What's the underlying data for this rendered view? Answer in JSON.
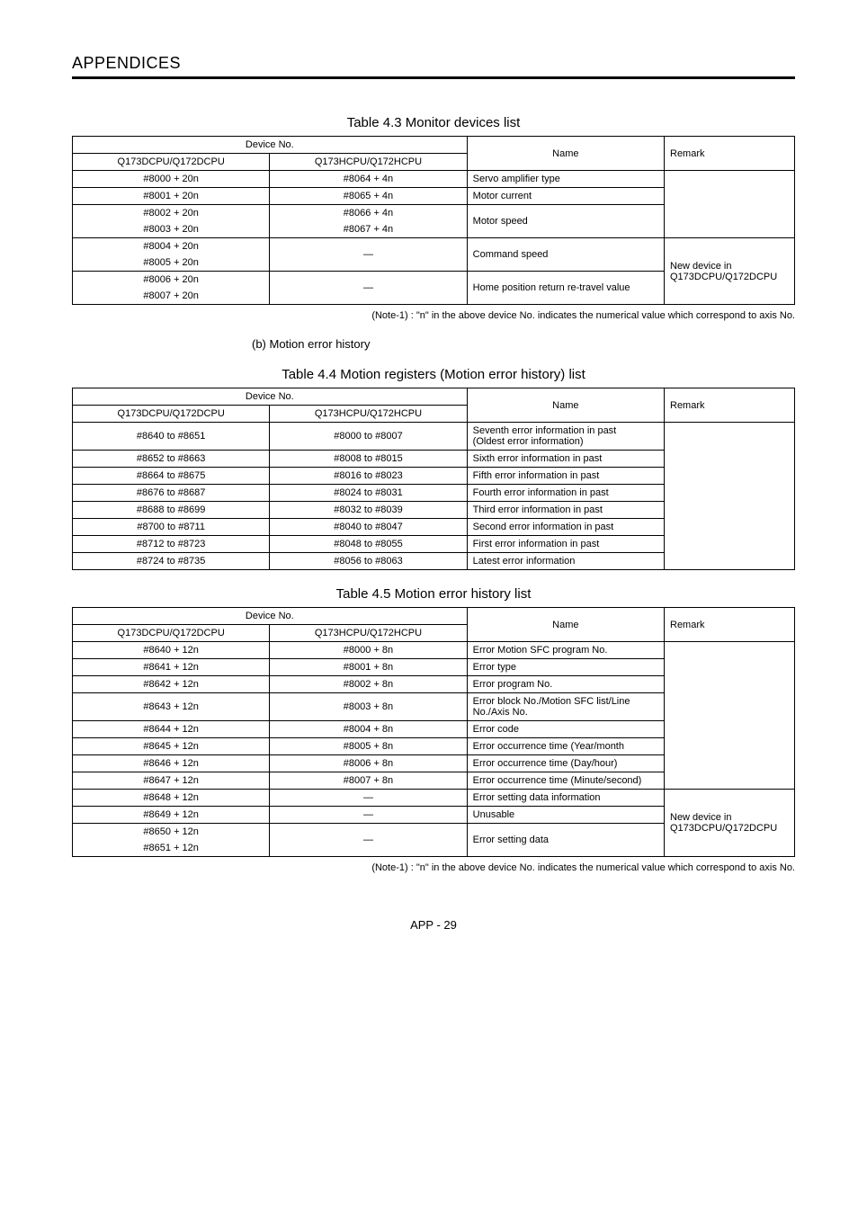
{
  "page": {
    "header": "APPENDICES",
    "footer": "APP - 29"
  },
  "table43": {
    "caption": "Table 4.3 Monitor devices list",
    "headers": {
      "device": "Device No.",
      "c1": "Q173DCPU/Q172DCPU",
      "c2": "Q173HCPU/Q172HCPU",
      "name": "Name",
      "remark": "Remark"
    },
    "rows": [
      {
        "d1": "#8000 + 20n",
        "d2": "#8064 + 4n",
        "name": "Servo amplifier type"
      },
      {
        "d1": "#8001 + 20n",
        "d2": "#8065 + 4n",
        "name": "Motor current"
      },
      {
        "d1a": "#8002 + 20n",
        "d1b": "#8003 + 20n",
        "d2a": "#8066 + 4n",
        "d2b": "#8067 + 4n",
        "name": "Motor speed"
      },
      {
        "d1a": "#8004 + 20n",
        "d1b": "#8005 + 20n",
        "d2": "—",
        "name": "Command speed"
      },
      {
        "d1a": "#8006 + 20n",
        "d1b": "#8007 + 20n",
        "d2": "—",
        "name": "Home position return re-travel value"
      }
    ],
    "remark_merged": "New device in Q173DCPU/Q172DCPU",
    "note": "(Note-1) : \"n\" in the above device No. indicates the numerical value which correspond to axis No."
  },
  "subsection_b": "(b)   Motion error history",
  "table44": {
    "caption": "Table 4.4 Motion registers (Motion error history) list",
    "headers": {
      "device": "Device No.",
      "c1": "Q173DCPU/Q172DCPU",
      "c2": "Q173HCPU/Q172HCPU",
      "name": "Name",
      "remark": "Remark"
    },
    "rows": [
      {
        "d1": "#8640 to #8651",
        "d2": "#8000 to #8007",
        "name": "Seventh error information in past\n(Oldest error information)"
      },
      {
        "d1": "#8652 to #8663",
        "d2": "#8008 to #8015",
        "name": "Sixth error information in past"
      },
      {
        "d1": "#8664 to #8675",
        "d2": "#8016 to #8023",
        "name": "Fifth error information in past"
      },
      {
        "d1": "#8676 to #8687",
        "d2": "#8024 to #8031",
        "name": "Fourth error information in past"
      },
      {
        "d1": "#8688 to #8699",
        "d2": "#8032 to #8039",
        "name": "Third error information in past"
      },
      {
        "d1": "#8700 to #8711",
        "d2": "#8040 to #8047",
        "name": "Second error information in past"
      },
      {
        "d1": "#8712 to #8723",
        "d2": "#8048 to #8055",
        "name": "First error information in past"
      },
      {
        "d1": "#8724 to #8735",
        "d2": "#8056 to #8063",
        "name": "Latest error information"
      }
    ]
  },
  "table45": {
    "caption": "Table 4.5 Motion error history list",
    "headers": {
      "device": "Device No.",
      "c1": "Q173DCPU/Q172DCPU",
      "c2": "Q173HCPU/Q172HCPU",
      "name": "Name",
      "remark": "Remark"
    },
    "rows": [
      {
        "d1": "#8640 + 12n",
        "d2": "#8000 + 8n",
        "name": "Error Motion SFC program No."
      },
      {
        "d1": "#8641 + 12n",
        "d2": "#8001 + 8n",
        "name": "Error type"
      },
      {
        "d1": "#8642 + 12n",
        "d2": "#8002 + 8n",
        "name": "Error program No."
      },
      {
        "d1": "#8643 + 12n",
        "d2": "#8003 + 8n",
        "name": "Error block No./Motion SFC list/Line No./Axis No."
      },
      {
        "d1": "#8644 + 12n",
        "d2": "#8004 + 8n",
        "name": "Error code"
      },
      {
        "d1": "#8645 + 12n",
        "d2": "#8005 + 8n",
        "name": "Error occurrence time (Year/month"
      },
      {
        "d1": "#8646 + 12n",
        "d2": "#8006 + 8n",
        "name": "Error occurrence time (Day/hour)"
      },
      {
        "d1": "#8647 + 12n",
        "d2": "#8007 + 8n",
        "name": "Error occurrence time (Minute/second)"
      },
      {
        "d1": "#8648 + 12n",
        "d2": "—",
        "name": "Error setting data information"
      },
      {
        "d1": "#8649 + 12n",
        "d2": "—",
        "name": "Unusable"
      },
      {
        "d1a": "#8650 + 12n",
        "d1b": "#8651 + 12n",
        "d2": "—",
        "name": "Error setting data"
      }
    ],
    "remark_merged": "New device in Q173DCPU/Q172DCPU",
    "note": "(Note-1) : \"n\" in the above device No. indicates the numerical value which correspond to axis No."
  }
}
